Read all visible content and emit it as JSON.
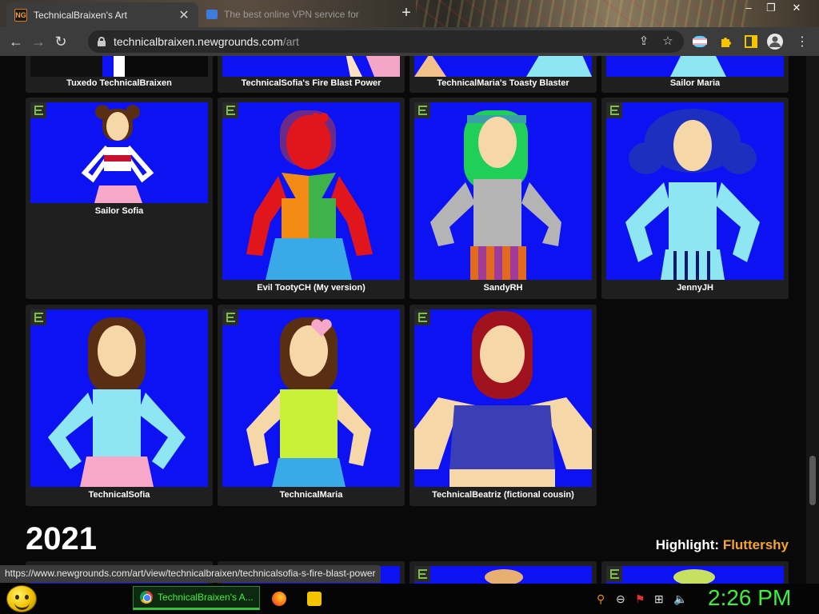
{
  "browser": {
    "tabs": [
      {
        "title": "TechnicalBraixen's Art",
        "favicon": "newgrounds-icon",
        "active": true
      },
      {
        "title": "The best online VPN service for",
        "favicon": "vpn-icon",
        "active": false
      }
    ],
    "new_tab": "+",
    "url_host": "technicalbraixen.newgrounds.com",
    "url_path": "/art",
    "status_url": "https://www.newgrounds.com/art/view/technicalbraixen/technicalsofia-s-fire-blast-power"
  },
  "gallery": {
    "top_row": [
      {
        "title": "Tuxedo TechnicalBraixen"
      },
      {
        "title": "TechnicalSofia's Fire Blast Power"
      },
      {
        "title": "TechnicalMaria's Toasty Blaster"
      },
      {
        "title": "Sailor Maria"
      }
    ],
    "row2": [
      {
        "title": "Sailor Sofia",
        "rating": "E"
      },
      {
        "title": "Evil TootyCH (My version)",
        "rating": "E"
      },
      {
        "title": "SandyRH",
        "rating": "E"
      },
      {
        "title": "JennyJH",
        "rating": "E"
      }
    ],
    "row3": [
      {
        "title": "TechnicalSofia",
        "rating": "E"
      },
      {
        "title": "TechnicalMaria",
        "rating": "E"
      },
      {
        "title": "TechnicalBeatriz (fictional cousin)",
        "rating": "E"
      }
    ]
  },
  "section": {
    "year": "2021",
    "highlight_label": "Highlight:",
    "highlight_name": "Fluttershy"
  },
  "taskbar": {
    "active_task": "TechnicalBraixen's A...",
    "clock": "2:26 PM"
  },
  "colors": {
    "accent_highlight": "#f6a623",
    "rating_green": "#7bc043",
    "art_background": "#0d12f2",
    "clock_green": "#3ef03e"
  }
}
